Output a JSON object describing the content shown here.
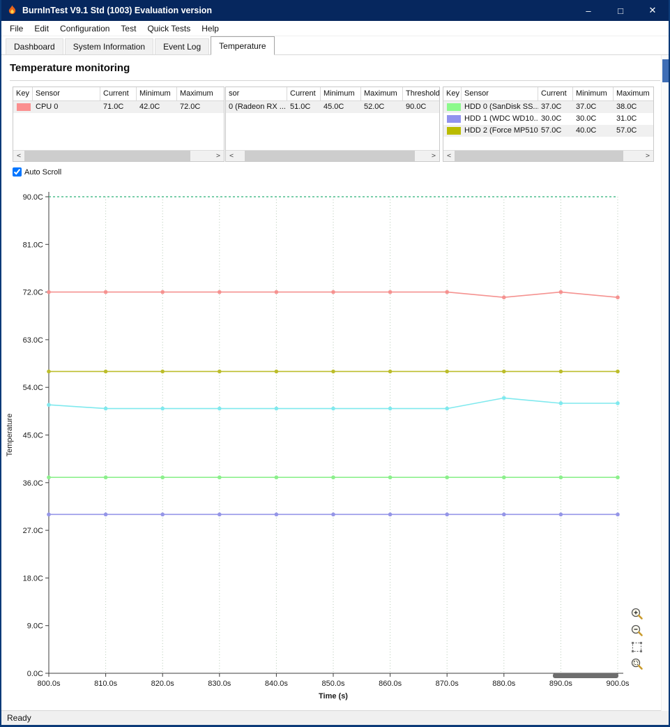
{
  "window": {
    "title": "BurnInTest V9.1 Std (1003) Evaluation version",
    "controls": {
      "minimize": "–",
      "maximize": "□",
      "close": "✕"
    },
    "status": "Ready"
  },
  "menu": {
    "items": [
      "File",
      "Edit",
      "Configuration",
      "Test",
      "Quick Tests",
      "Help"
    ]
  },
  "tabs": {
    "items": [
      {
        "label": "Dashboard"
      },
      {
        "label": "System Information"
      },
      {
        "label": "Event Log"
      },
      {
        "label": "Temperature"
      }
    ]
  },
  "section": {
    "title": "Temperature monitoring"
  },
  "auto_scroll": {
    "label": "Auto Scroll",
    "checked": true
  },
  "scrollbar": {
    "left_arrow": "<",
    "right_arrow": ">"
  },
  "tables": [
    {
      "columns": [
        "Key",
        "Sensor",
        "Current",
        "Minimum",
        "Maximum"
      ],
      "rows": [
        {
          "key_color": "#fb8f8f",
          "sensor": "CPU 0",
          "current": "71.0C",
          "minimum": "42.0C",
          "maximum": "72.0C"
        }
      ]
    },
    {
      "columns": [
        "sor",
        "Current",
        "Minimum",
        "Maximum",
        "Threshold"
      ],
      "rows": [
        {
          "sensor": "0  (Radeon RX ...",
          "current": "51.0C",
          "minimum": "45.0C",
          "maximum": "52.0C",
          "threshold": "90.0C"
        }
      ]
    },
    {
      "columns": [
        "Key",
        "Sensor",
        "Current",
        "Minimum",
        "Maximum"
      ],
      "rows": [
        {
          "key_color": "#8cfa8c",
          "sensor": "HDD 0 (SanDisk SS...",
          "current": "37.0C",
          "minimum": "37.0C",
          "maximum": "38.0C"
        },
        {
          "key_color": "#9192ee",
          "sensor": "HDD 1 (WDC WD10...",
          "current": "30.0C",
          "minimum": "30.0C",
          "maximum": "31.0C"
        },
        {
          "key_color": "#babb00",
          "sensor": "HDD 2 (Force MP510)",
          "current": "57.0C",
          "minimum": "40.0C",
          "maximum": "57.0C"
        }
      ]
    }
  ],
  "chart_data": {
    "type": "line",
    "title": "",
    "xlabel": "Time (s)",
    "ylabel": "Temperature",
    "xlim": [
      800,
      900
    ],
    "ylim": [
      0,
      90
    ],
    "grid": "vertical-dotted",
    "legend_position": "none",
    "x": [
      800,
      810,
      820,
      830,
      840,
      850,
      860,
      870,
      880,
      890,
      900
    ],
    "x_ticks": [
      "800.0s",
      "810.0s",
      "820.0s",
      "830.0s",
      "840.0s",
      "850.0s",
      "860.0s",
      "870.0s",
      "880.0s",
      "890.0s",
      "900.0s"
    ],
    "y_ticks": [
      "90.0C",
      "81.0C",
      "72.0C",
      "63.0C",
      "54.0C",
      "45.0C",
      "36.0C",
      "27.0C",
      "18.0C",
      "9.0C",
      "0.0C"
    ],
    "series": [
      {
        "name": "Threshold",
        "color": "#4fbe8d",
        "dashed": true,
        "values": [
          90,
          90,
          90,
          90,
          90,
          90,
          90,
          90,
          90,
          90,
          90
        ]
      },
      {
        "name": "CPU 0",
        "color": "#f59290",
        "dashed": false,
        "values": [
          72,
          72,
          72,
          72,
          72,
          72,
          72,
          72,
          71,
          72,
          71
        ]
      },
      {
        "name": "GPU 0 (Radeon RX)",
        "color": "#7fe9ee",
        "dashed": false,
        "values": [
          50.7,
          50,
          50,
          50,
          50,
          50,
          50,
          50,
          52,
          51,
          51
        ]
      },
      {
        "name": "HDD 0 (SanDisk SSD)",
        "color": "#8cf08c",
        "dashed": false,
        "values": [
          37,
          37,
          37,
          37,
          37,
          37,
          37,
          37,
          37,
          37,
          37
        ]
      },
      {
        "name": "HDD 1 (WDC WD10)",
        "color": "#9596e8",
        "dashed": false,
        "values": [
          30,
          30,
          30,
          30,
          30,
          30,
          30,
          30,
          30,
          30,
          30
        ]
      },
      {
        "name": "HDD 2 (Force MP510)",
        "color": "#bcbd2b",
        "dashed": false,
        "values": [
          57,
          57,
          57,
          57,
          57,
          57,
          57,
          57,
          57,
          57,
          57
        ]
      }
    ]
  }
}
